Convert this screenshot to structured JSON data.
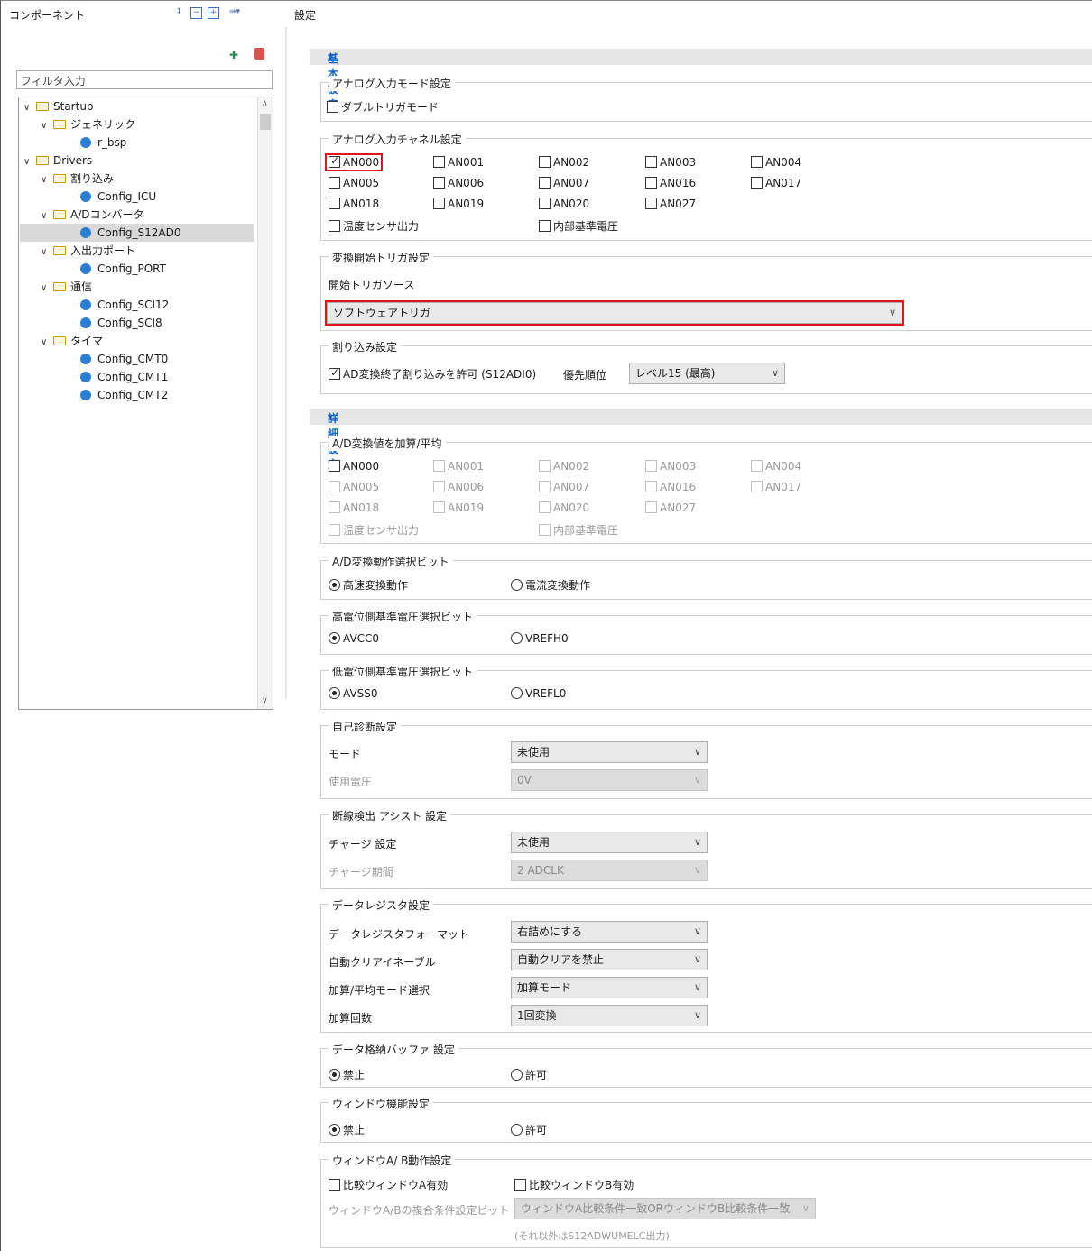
{
  "colors": {
    "section_header": "#1565c0",
    "highlight": "#e0141e",
    "selected_row": "#d9d9d9"
  },
  "left_pane": {
    "title": "コンポーネント",
    "filter_placeholder": "フィルタ入力",
    "tree": [
      {
        "label": "Startup",
        "type": "folder"
      },
      {
        "label": "ジェネリック",
        "type": "folder"
      },
      {
        "label": "r_bsp",
        "type": "config"
      },
      {
        "label": "Drivers",
        "type": "folder"
      },
      {
        "label": "割り込み",
        "type": "folder"
      },
      {
        "label": "Config_ICU",
        "type": "config"
      },
      {
        "label": "A/Dコンバータ",
        "type": "folder"
      },
      {
        "label": "Config_S12AD0",
        "type": "config",
        "selected": true
      },
      {
        "label": "入出力ポート",
        "type": "folder"
      },
      {
        "label": "Config_PORT",
        "type": "config"
      },
      {
        "label": "通信",
        "type": "folder"
      },
      {
        "label": "Config_SCI12",
        "type": "config"
      },
      {
        "label": "Config_SCI8",
        "type": "config"
      },
      {
        "label": "タイマ",
        "type": "folder"
      },
      {
        "label": "Config_CMT0",
        "type": "config"
      },
      {
        "label": "Config_CMT1",
        "type": "config"
      },
      {
        "label": "Config_CMT2",
        "type": "config"
      }
    ]
  },
  "right_pane": {
    "title": "設定",
    "basic": {
      "header": "基本設定",
      "analog_mode": {
        "label": "アナログ入力モード設定",
        "double_trigger": "ダブルトリガモード"
      },
      "channel": {
        "label": "アナログ入力チャネル設定",
        "items": [
          "AN000",
          "AN001",
          "AN002",
          "AN003",
          "AN004",
          "AN005",
          "AN006",
          "AN007",
          "AN016",
          "AN017",
          "AN018",
          "AN019",
          "AN020",
          "AN027"
        ],
        "checked": "AN000",
        "temp": "温度センサ出力",
        "vref": "内部基準電圧"
      },
      "trigger": {
        "label": "変換開始トリガ設定",
        "source_label": "開始トリガソース",
        "value": "ソフトウェアトリガ"
      },
      "interrupt": {
        "label": "割り込み設定",
        "enable": "AD変換終了割り込みを許可 (S12ADI0)",
        "priority_label": "優先順位",
        "priority_value": "レベル15 (最高)"
      }
    },
    "detail": {
      "header": "詳細設定",
      "addavg": {
        "label": "A/D変換値を加算/平均",
        "items": [
          "AN000",
          "AN001",
          "AN002",
          "AN003",
          "AN004",
          "AN005",
          "AN006",
          "AN007",
          "AN016",
          "AN017",
          "AN018",
          "AN019",
          "AN020",
          "AN027"
        ],
        "temp": "温度センサ出力",
        "vref": "内部基準電圧"
      },
      "mode": {
        "label": "A/D変換動作選択ビット",
        "opt1": "高速変換動作",
        "opt2": "電流変換動作"
      },
      "high_ref": {
        "label": "高電位側基準電圧選択ビット",
        "opt1": "AVCC0",
        "opt2": "VREFH0"
      },
      "low_ref": {
        "label": "低電位側基準電圧選択ビット",
        "opt1": "AVSS0",
        "opt2": "VREFL0"
      },
      "selfdiag": {
        "label": "自己診断設定",
        "mode_label": "モード",
        "mode_value": "未使用",
        "volt_label": "使用電圧",
        "volt_value": "0V"
      },
      "disconnect": {
        "label": "断線検出 アシスト 設定",
        "charge_label": "チャージ 設定",
        "charge_value": "未使用",
        "period_label": "チャージ期間",
        "period_value": "2 ADCLK"
      },
      "datareg": {
        "label": "データレジスタ設定",
        "format_label": "データレジスタフォーマット",
        "format_value": "右詰めにする",
        "autoclear_label": "自動クリアイネーブル",
        "autoclear_value": "自動クリアを禁止",
        "addavg_label": "加算/平均モード選択",
        "addavg_value": "加算モード",
        "count_label": "加算回数",
        "count_value": "1回変換"
      },
      "buffer": {
        "label": "データ格納バッファ 設定",
        "opt1": "禁止",
        "opt2": "許可"
      },
      "window": {
        "label": "ウィンドウ機能設定",
        "opt1": "禁止",
        "opt2": "許可"
      },
      "windowab": {
        "label": "ウィンドウA/ B動作設定",
        "a_enable": "比較ウィンドウA有効",
        "b_enable": "比較ウィンドウB有効",
        "compound_label": "ウィンドウA/Bの複合条件設定ビット",
        "compound_value": "ウィンドウA比較条件一致ORウィンドウB比較条件一致",
        "note": "(それ以外はS12ADWUMELC出力)"
      }
    }
  }
}
